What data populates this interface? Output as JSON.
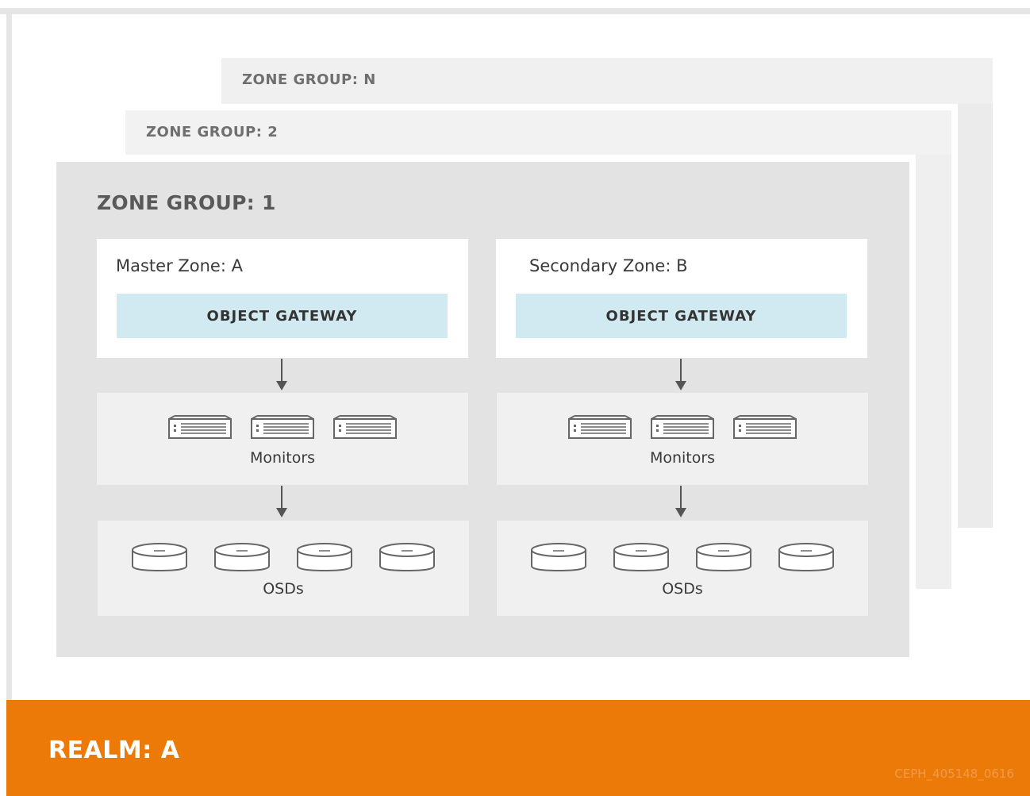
{
  "zone_groups": {
    "n": {
      "title": "ZONE GROUP: N"
    },
    "two": {
      "title": "ZONE GROUP: 2"
    },
    "one": {
      "title": "ZONE GROUP: 1"
    }
  },
  "zones": [
    {
      "title": "Master Zone: A",
      "gateway": "OBJECT GATEWAY",
      "monitors_label": "Monitors",
      "osds_label": "OSDs",
      "monitor_count": 3,
      "osd_count": 4
    },
    {
      "title": "Secondary Zone: B",
      "gateway": "OBJECT GATEWAY",
      "monitors_label": "Monitors",
      "osds_label": "OSDs",
      "monitor_count": 3,
      "osd_count": 4
    }
  ],
  "realm": {
    "title": "REALM: A",
    "code": "CEPH_405148_0616"
  },
  "colors": {
    "realm": "#ec7a08",
    "gateway": "#d1e9f0",
    "zone_group": "#e3e3e3",
    "tier": "#f0f0f0"
  },
  "icons": {
    "monitor": "server-icon",
    "osd": "disk-icon",
    "arrow": "arrow-down-icon"
  }
}
